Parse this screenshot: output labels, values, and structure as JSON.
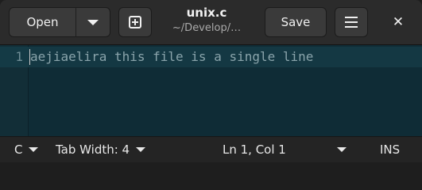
{
  "header": {
    "open_label": "Open",
    "title": "unix.c",
    "subtitle": "~/Develop/…",
    "save_label": "Save",
    "close_glyph": "✕"
  },
  "editor": {
    "line_numbers": [
      "1"
    ],
    "lines": [
      "aejiaelira this file is a single line"
    ]
  },
  "statusbar": {
    "language": "C",
    "tab_width": "Tab Width: 4",
    "cursor_position": "Ln 1, Col 1",
    "insert_mode": "INS"
  },
  "icons": {
    "open_menu": "chevron-down-icon",
    "new_tab": "new-tab-icon",
    "main_menu": "hamburger-menu-icon",
    "close": "close-icon"
  },
  "colors": {
    "headerbar": "#2b2b2b",
    "editor_background": "#0f2c36",
    "current_line": "#143843",
    "text": "#8aa4ab",
    "statusbar": "#242424"
  }
}
